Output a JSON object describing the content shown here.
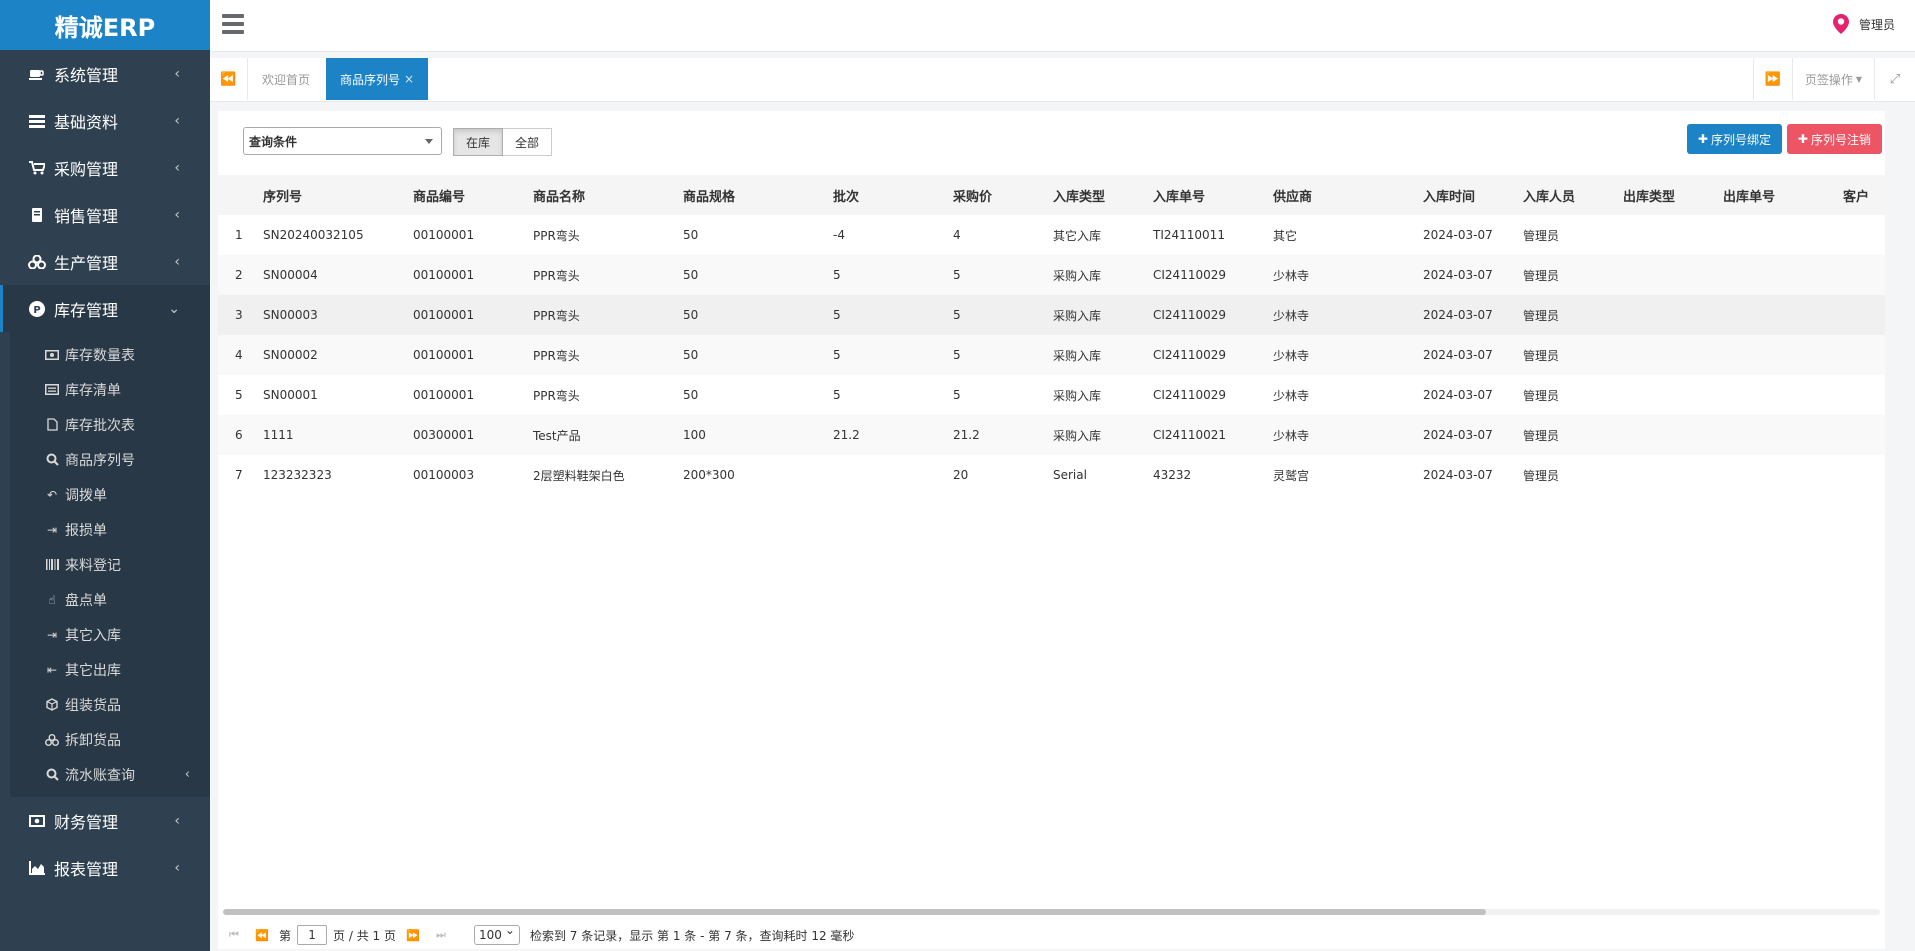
{
  "app": {
    "logo": "精诚ERP",
    "user": "管理员"
  },
  "sidebar": {
    "items": [
      {
        "label": "系统管理",
        "icon": "coffee-icon"
      },
      {
        "label": "基础资料",
        "icon": "list-icon"
      },
      {
        "label": "采购管理",
        "icon": "cart-icon"
      },
      {
        "label": "销售管理",
        "icon": "book-icon"
      },
      {
        "label": "生产管理",
        "icon": "cubes-icon"
      },
      {
        "label": "库存管理",
        "icon": "parking-icon",
        "active": true
      },
      {
        "label": "财务管理",
        "icon": "money-icon"
      },
      {
        "label": "报表管理",
        "icon": "area-chart-icon"
      }
    ],
    "submenu": [
      {
        "label": "库存数量表",
        "icon": "money-icon"
      },
      {
        "label": "库存清单",
        "icon": "list-alt-icon"
      },
      {
        "label": "库存批次表",
        "icon": "file-icon"
      },
      {
        "label": "商品序列号",
        "icon": "search-icon"
      },
      {
        "label": "调拨单",
        "icon": "reply-icon"
      },
      {
        "label": "报损单",
        "icon": "sign-in-icon"
      },
      {
        "label": "来料登记",
        "icon": "barcode-icon"
      },
      {
        "label": "盘点单",
        "icon": "hand-icon"
      },
      {
        "label": "其它入库",
        "icon": "sign-in-icon"
      },
      {
        "label": "其它出库",
        "icon": "sign-out-icon"
      },
      {
        "label": "组装货品",
        "icon": "cube-icon"
      },
      {
        "label": "拆卸货品",
        "icon": "cubes-icon"
      },
      {
        "label": "流水账查询",
        "icon": "search-icon"
      }
    ]
  },
  "tabs": {
    "home": "欢迎首页",
    "current": "商品序列号",
    "close": "×",
    "ops": "页签操作"
  },
  "toolbar": {
    "filter": "查询条件",
    "in_stock": "在库",
    "all": "全部",
    "bind": "序列号绑定",
    "cancel": "序列号注销"
  },
  "table": {
    "columns": [
      "序列号",
      "商品编号",
      "商品名称",
      "商品规格",
      "批次",
      "采购价",
      "入库类型",
      "入库单号",
      "供应商",
      "入库时间",
      "入库人员",
      "出库类型",
      "出库单号",
      "客户"
    ],
    "rows": [
      [
        "1",
        "SN20240032105",
        "00100001",
        "PPR弯头",
        "50",
        "-4",
        "4",
        "其它入库",
        "TI24110011",
        "其它",
        "2024-03-07",
        "管理员",
        "",
        "",
        ""
      ],
      [
        "2",
        "SN00004",
        "00100001",
        "PPR弯头",
        "50",
        "5",
        "5",
        "采购入库",
        "CI24110029",
        "少林寺",
        "2024-03-07",
        "管理员",
        "",
        "",
        ""
      ],
      [
        "3",
        "SN00003",
        "00100001",
        "PPR弯头",
        "50",
        "5",
        "5",
        "采购入库",
        "CI24110029",
        "少林寺",
        "2024-03-07",
        "管理员",
        "",
        "",
        ""
      ],
      [
        "4",
        "SN00002",
        "00100001",
        "PPR弯头",
        "50",
        "5",
        "5",
        "采购入库",
        "CI24110029",
        "少林寺",
        "2024-03-07",
        "管理员",
        "",
        "",
        ""
      ],
      [
        "5",
        "SN00001",
        "00100001",
        "PPR弯头",
        "50",
        "5",
        "5",
        "采购入库",
        "CI24110029",
        "少林寺",
        "2024-03-07",
        "管理员",
        "",
        "",
        ""
      ],
      [
        "6",
        "1111",
        "00300001",
        "Test产品",
        "100",
        "21.2",
        "21.2",
        "采购入库",
        "CI24110021",
        "少林寺",
        "2024-03-07",
        "管理员",
        "",
        "",
        ""
      ],
      [
        "7",
        "123232323",
        "00100003",
        "2层塑料鞋架白色",
        "200*300",
        "",
        "20",
        "Serial",
        "43232",
        "灵鹫宫",
        "2024-03-07",
        "管理员",
        "",
        "",
        ""
      ]
    ]
  },
  "pager": {
    "page_prefix": "第",
    "page": "1",
    "page_suffix": "页 / 共 1 页",
    "page_size": "100",
    "info": "检索到 7 条记录，显示 第 1 条 - 第 7 条，查询耗时 12 毫秒"
  },
  "colors": {
    "primary": "#1c84c6",
    "danger": "#ed5565",
    "sidebar": "#2f4050",
    "pin": "#e6226e"
  }
}
